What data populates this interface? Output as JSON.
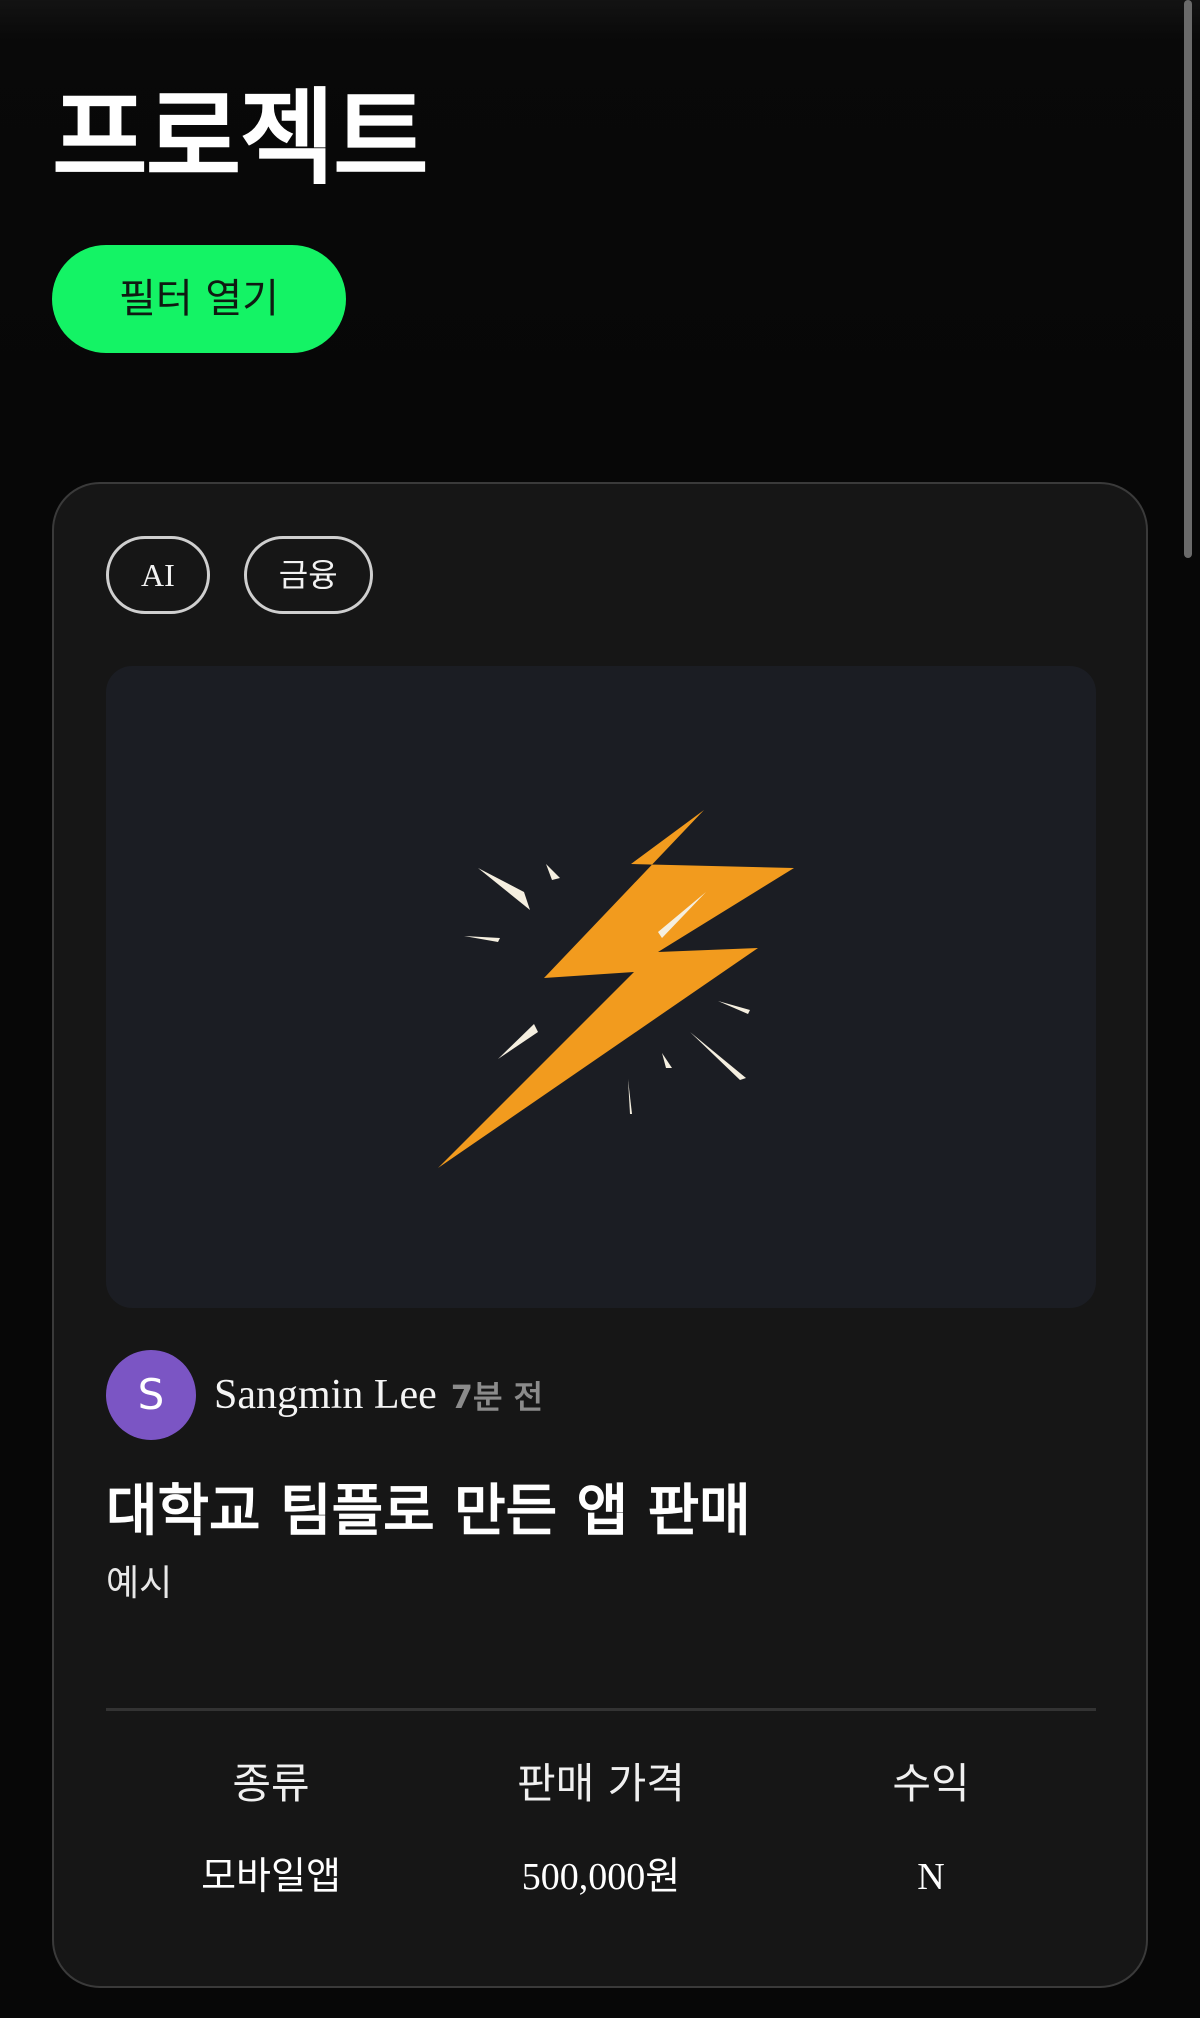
{
  "header": {
    "title": "프로젝트",
    "filter_button_label": "필터 열기"
  },
  "project_card": {
    "tags": [
      "AI",
      "금융"
    ],
    "thumbnail": {
      "icon": "lightning-bolt-icon",
      "colors": {
        "bolt": "#f29b1e",
        "sparks": "#f5efe0",
        "background": "#1b1d23"
      }
    },
    "author": {
      "avatar_initial": "S",
      "avatar_color": "#7b55c4",
      "name": "Sangmin Lee",
      "time": "7분 전"
    },
    "title": "대학교 팀플로 만든 앱 판매",
    "description": "예시",
    "stats": [
      {
        "label": "종류",
        "value": "모바일앱"
      },
      {
        "label": "판매 가격",
        "value": "500,000원"
      },
      {
        "label": "수익",
        "value": "N"
      }
    ]
  },
  "theme": {
    "accent": "#14f365",
    "background": "#070707",
    "card": "#161616"
  }
}
